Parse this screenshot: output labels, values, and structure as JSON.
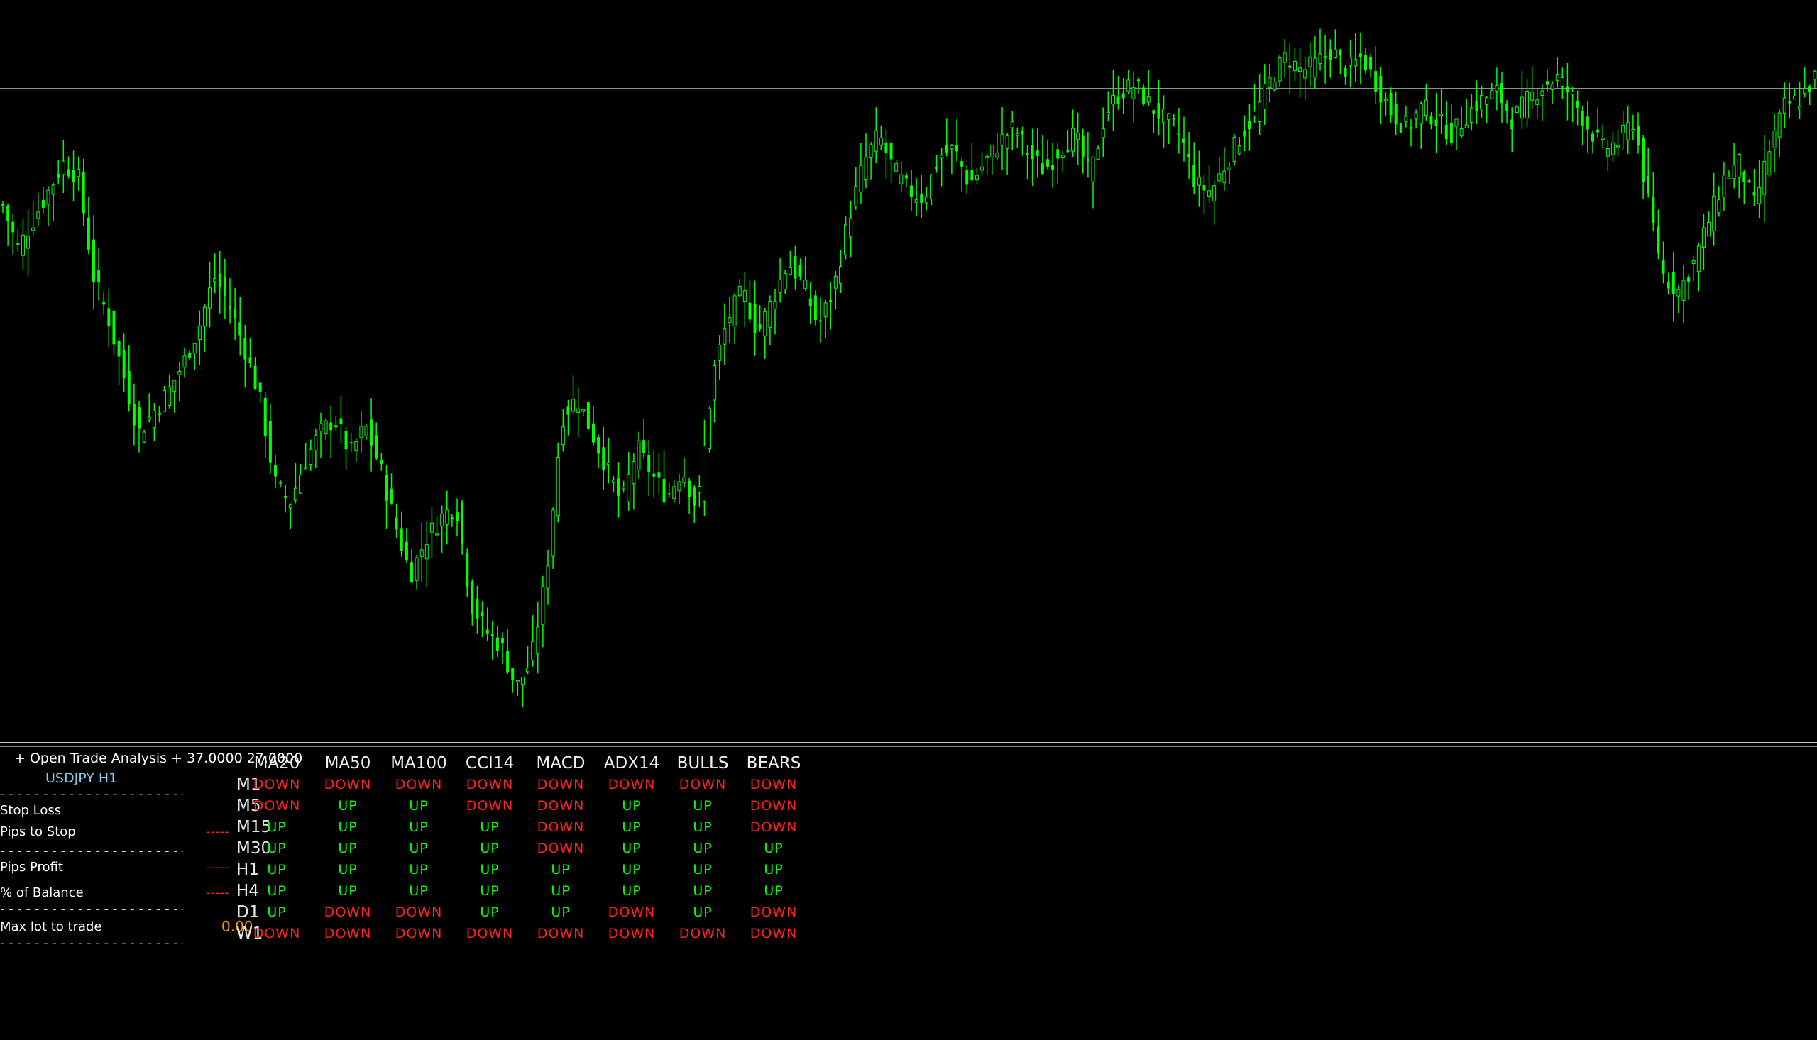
{
  "colors": {
    "background": "#000000",
    "candle": "#00ff00",
    "price_line": "#c0c0c0",
    "up": "#00ff00",
    "down": "#ff2020",
    "symbol_text": "#87ceeb",
    "lot_value": "#ff9900"
  },
  "chart_data": {
    "type": "candlestick",
    "symbol": "USDJPY",
    "timeframe": "H1",
    "price_line_level": 0.885,
    "close_levels": [
      0.72,
      0.66,
      0.7,
      0.74,
      0.78,
      0.76,
      0.62,
      0.56,
      0.48,
      0.4,
      0.43,
      0.46,
      0.5,
      0.55,
      0.62,
      0.58,
      0.52,
      0.45,
      0.33,
      0.3,
      0.36,
      0.4,
      0.42,
      0.37,
      0.41,
      0.35,
      0.27,
      0.2,
      0.25,
      0.28,
      0.3,
      0.16,
      0.12,
      0.1,
      0.04,
      0.08,
      0.2,
      0.42,
      0.45,
      0.4,
      0.35,
      0.3,
      0.38,
      0.34,
      0.31,
      0.35,
      0.29,
      0.48,
      0.56,
      0.6,
      0.54,
      0.59,
      0.64,
      0.61,
      0.55,
      0.6,
      0.7,
      0.78,
      0.82,
      0.77,
      0.74,
      0.73,
      0.79,
      0.8,
      0.75,
      0.78,
      0.81,
      0.83,
      0.79,
      0.77,
      0.8,
      0.82,
      0.76,
      0.85,
      0.88,
      0.89,
      0.86,
      0.84,
      0.82,
      0.75,
      0.74,
      0.78,
      0.82,
      0.85,
      0.9,
      0.93,
      0.91,
      0.92,
      0.94,
      0.91,
      0.93,
      0.89,
      0.85,
      0.83,
      0.86,
      0.84,
      0.82,
      0.85,
      0.87,
      0.88,
      0.84,
      0.87,
      0.89,
      0.9,
      0.87,
      0.83,
      0.8,
      0.81,
      0.84,
      0.72,
      0.62,
      0.6,
      0.64,
      0.7,
      0.76,
      0.78,
      0.72,
      0.8,
      0.86,
      0.87,
      0.9
    ]
  },
  "panel": {
    "title": "+ Open Trade Analysis + 37.0000 27.0000",
    "symbol_tf": "USDJPY  H1",
    "labels": [
      "Stop Loss",
      "Pips to Stop",
      "Pips Profit",
      "% of Balance",
      "Max lot to trade"
    ],
    "max_lot_value": "0.00"
  },
  "matrix": {
    "columns": [
      "MA20",
      "MA50",
      "MA100",
      "CCI14",
      "MACD",
      "ADX14",
      "BULLS",
      "BEARS"
    ],
    "rows": [
      {
        "tf": "M1",
        "values": [
          "DOWN",
          "DOWN",
          "DOWN",
          "DOWN",
          "DOWN",
          "DOWN",
          "DOWN",
          "DOWN"
        ]
      },
      {
        "tf": "M5",
        "values": [
          "DOWN",
          "UP",
          "UP",
          "DOWN",
          "DOWN",
          "UP",
          "UP",
          "DOWN"
        ]
      },
      {
        "tf": "M15",
        "values": [
          "UP",
          "UP",
          "UP",
          "UP",
          "DOWN",
          "UP",
          "UP",
          "DOWN"
        ]
      },
      {
        "tf": "M30",
        "values": [
          "UP",
          "UP",
          "UP",
          "UP",
          "DOWN",
          "UP",
          "UP",
          "UP"
        ]
      },
      {
        "tf": "H1",
        "values": [
          "UP",
          "UP",
          "UP",
          "UP",
          "UP",
          "UP",
          "UP",
          "UP"
        ]
      },
      {
        "tf": "H4",
        "values": [
          "UP",
          "UP",
          "UP",
          "UP",
          "UP",
          "UP",
          "UP",
          "UP"
        ]
      },
      {
        "tf": "D1",
        "values": [
          "UP",
          "DOWN",
          "DOWN",
          "UP",
          "UP",
          "DOWN",
          "UP",
          "DOWN"
        ]
      },
      {
        "tf": "W1",
        "values": [
          "DOWN",
          "DOWN",
          "DOWN",
          "DOWN",
          "DOWN",
          "DOWN",
          "DOWN",
          "DOWN"
        ]
      }
    ]
  }
}
